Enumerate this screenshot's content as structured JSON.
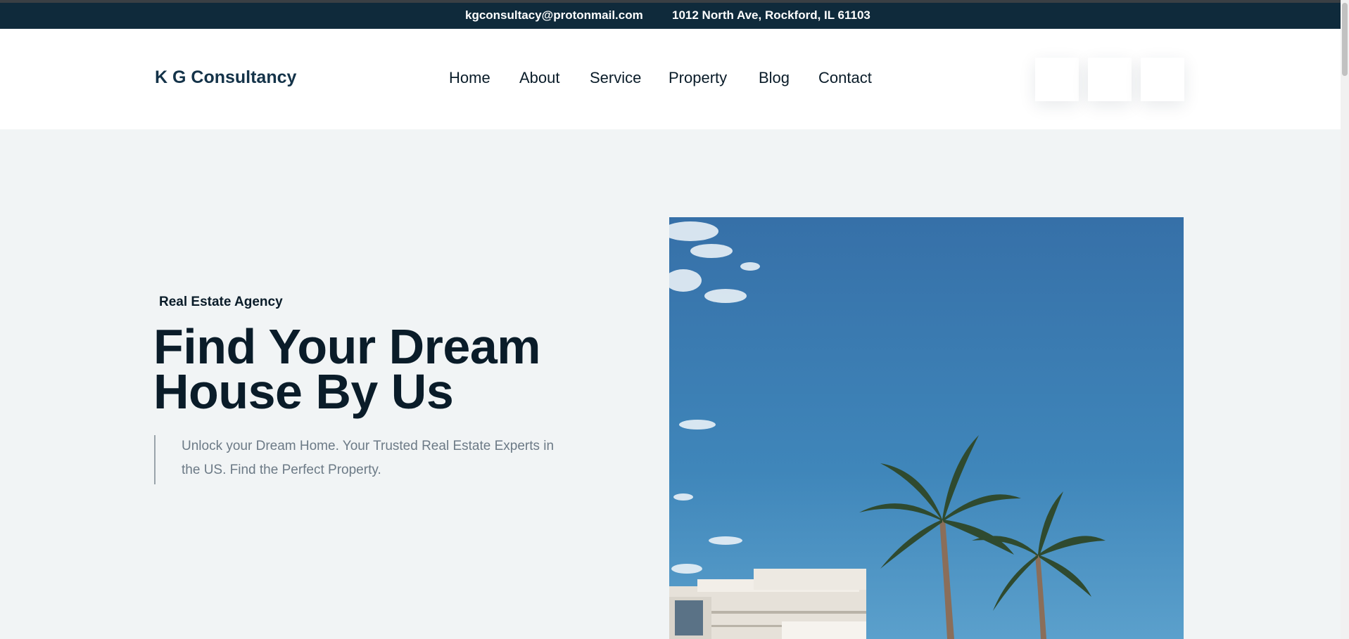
{
  "topbar": {
    "email": "kgconsultacy@protonmail.com",
    "address": "1012 North Ave, Rockford, IL 61103"
  },
  "header": {
    "logo": "K G Consultancy",
    "nav": [
      "Home",
      "About",
      "Service",
      "Property",
      "Blog",
      "Contact"
    ],
    "social_icons": [
      "social-icon",
      "social-icon",
      "social-icon"
    ]
  },
  "hero": {
    "tagline": "Real Estate Agency",
    "headline_line1": "Find Your Dream",
    "headline_line2": "House By Us",
    "description": "Unlock your Dream Home. Your Trusted Real Estate Experts in the US. Find the Perfect Property."
  },
  "colors": {
    "topbar_bg": "#0f2a3b",
    "hero_bg": "#f1f4f5",
    "heading": "#0a1c29",
    "logo": "#143349",
    "description": "#6c7a86"
  }
}
